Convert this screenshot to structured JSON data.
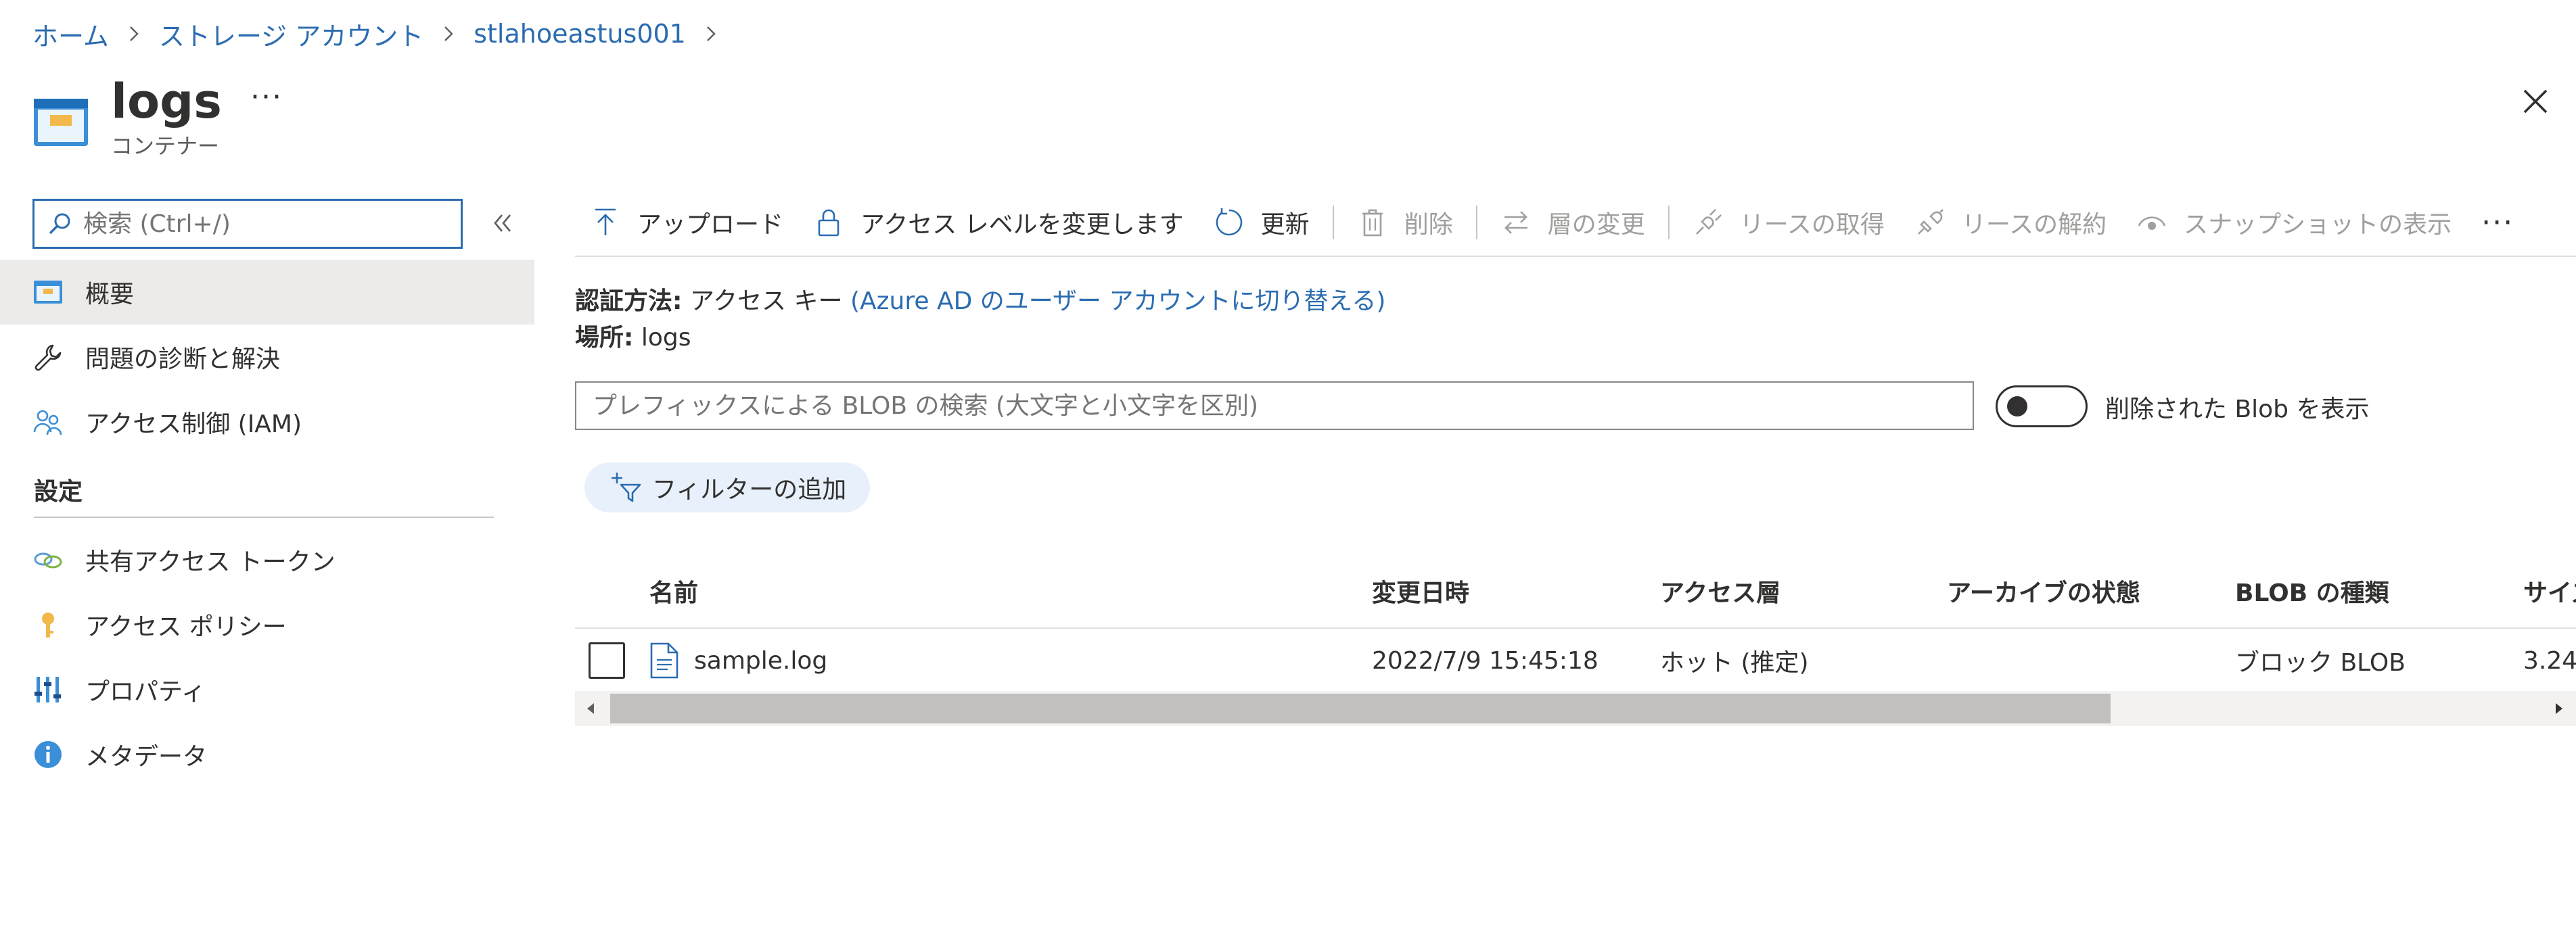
{
  "breadcrumb": {
    "items": [
      "ホーム",
      "ストレージ アカウント",
      "stlahoeastus001"
    ]
  },
  "header": {
    "title": "logs",
    "subtitle": "コンテナー",
    "more": "···"
  },
  "sidebar": {
    "search_placeholder": "検索 (Ctrl+/)",
    "items": [
      {
        "label": "概要",
        "icon": "container-icon"
      },
      {
        "label": "問題の診断と解決",
        "icon": "wrench-icon"
      },
      {
        "label": "アクセス制御 (IAM)",
        "icon": "people-icon"
      }
    ],
    "section_title": "設定",
    "settings_items": [
      {
        "label": "共有アクセス トークン",
        "icon": "link-icon"
      },
      {
        "label": "アクセス ポリシー",
        "icon": "key-icon"
      },
      {
        "label": "プロパティ",
        "icon": "properties-icon"
      },
      {
        "label": "メタデータ",
        "icon": "info-icon"
      }
    ]
  },
  "toolbar": {
    "upload": "アップロード",
    "change_access": "アクセス レベルを変更します",
    "refresh": "更新",
    "delete": "削除",
    "change_tier": "層の変更",
    "acquire_lease": "リースの取得",
    "break_lease": "リースの解約",
    "show_snapshots": "スナップショットの表示",
    "more": "···"
  },
  "info": {
    "auth_label": "認証方法:",
    "auth_value": "アクセス キー",
    "auth_link": "(Azure AD のユーザー アカウントに切り替える)",
    "location_label": "場所:",
    "location_value": "logs"
  },
  "filters": {
    "prefix_placeholder": "プレフィックスによる BLOB の検索 (大文字と小文字を区別)",
    "show_deleted_label": "削除された Blob を表示",
    "show_deleted": false,
    "add_filter": "フィルターの追加"
  },
  "table": {
    "headers": {
      "name": "名前",
      "modified": "変更日時",
      "tier": "アクセス層",
      "archive": "アーカイブの状態",
      "type": "BLOB の種類",
      "size": "サイズ"
    },
    "rows": [
      {
        "name": "sample.log",
        "modified": "2022/7/9 15:45:18",
        "tier": "ホット (推定)",
        "archive": "",
        "type": "ブロック BLOB",
        "size": "3.24"
      }
    ]
  },
  "colors": {
    "link": "#2b6cb0",
    "active_nav": "#edebe9",
    "filter_pill": "#e8f1fb"
  }
}
